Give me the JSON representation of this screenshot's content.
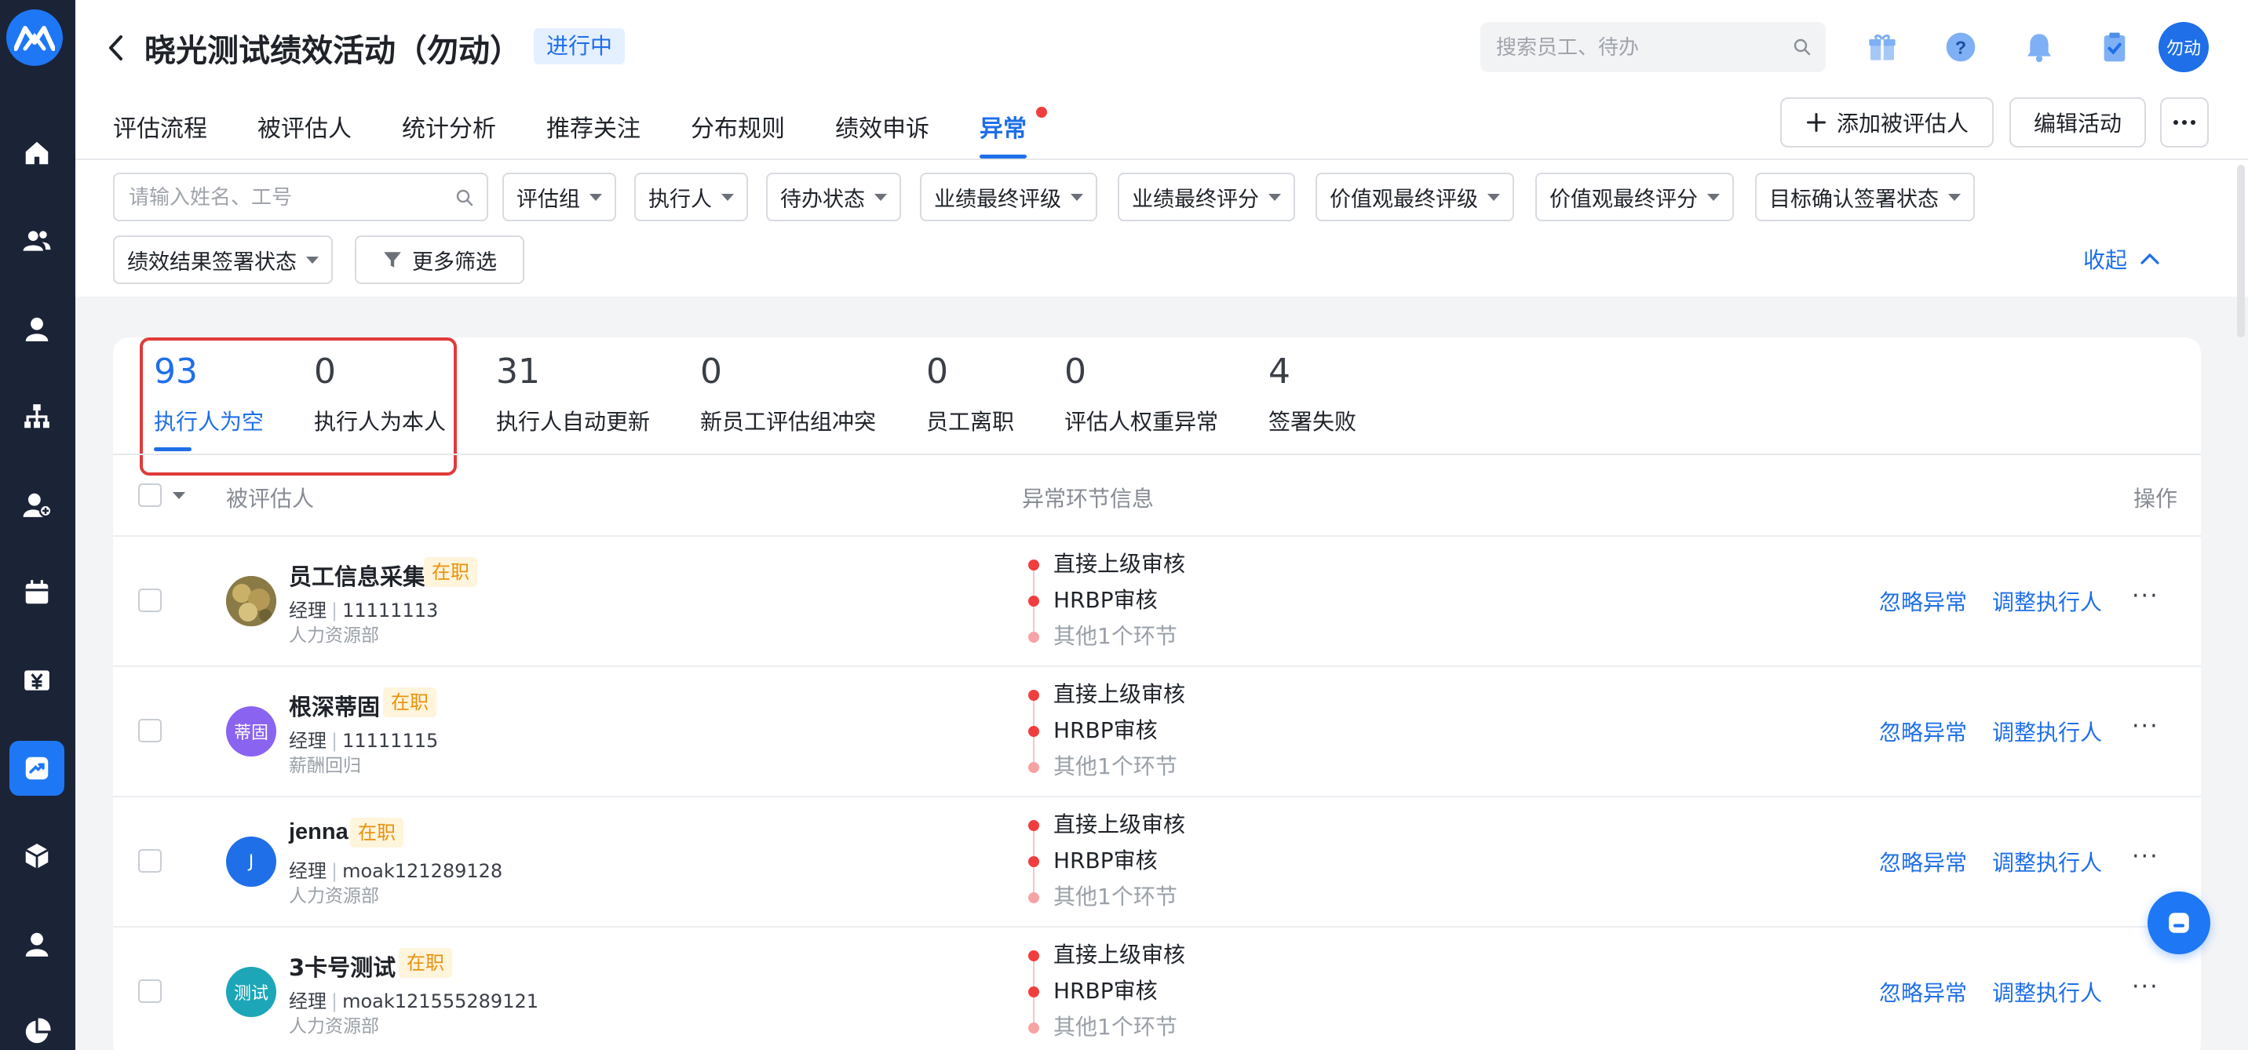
{
  "header": {
    "title": "晓光测试绩效活动（勿动）",
    "status": "进行中",
    "search_placeholder": "搜索员工、待办",
    "user_avatar": "勿动"
  },
  "tabs": [
    {
      "label": "评估流程"
    },
    {
      "label": "被评估人"
    },
    {
      "label": "统计分析"
    },
    {
      "label": "推荐关注"
    },
    {
      "label": "分布规则"
    },
    {
      "label": "绩效申诉"
    },
    {
      "label": "异常",
      "active": true,
      "dot": true
    }
  ],
  "actions": {
    "add_evaluatee": "添加被评估人",
    "edit_activity": "编辑活动"
  },
  "filters": {
    "name_placeholder": "请输入姓名、工号",
    "selects": [
      "评估组",
      "执行人",
      "待办状态",
      "业绩最终评级",
      "业绩最终评分",
      "价值观最终评级",
      "价值观最终评分",
      "目标确认签署状态",
      "绩效结果签署状态"
    ],
    "more": "更多筛选",
    "collapse": "收起"
  },
  "stats": [
    {
      "value": "93",
      "label": "执行人为空",
      "active": true
    },
    {
      "value": "0",
      "label": "执行人为本人"
    },
    {
      "value": "31",
      "label": "执行人自动更新"
    },
    {
      "value": "0",
      "label": "新员工评估组冲突"
    },
    {
      "value": "0",
      "label": "员工离职"
    },
    {
      "value": "0",
      "label": "评估人权重异常"
    },
    {
      "value": "4",
      "label": "签署失败"
    }
  ],
  "table": {
    "columns": {
      "evaluatee": "被评估人",
      "exception_info": "异常环节信息",
      "operation": "操作"
    },
    "rows": [
      {
        "name": "员工信息采集",
        "status": "在职",
        "title": "经理",
        "id": "11111113",
        "dept": "人力资源部",
        "avatar_text": "",
        "avatar_color": "#9a8a52",
        "steps": [
          "直接上级审核",
          "HRBP审核",
          "其他1个环节"
        ],
        "ignore": "忽略异常",
        "adjust": "调整执行人"
      },
      {
        "name": "根深蒂固",
        "status": "在职",
        "title": "经理",
        "id": "11111115",
        "dept": "薪酬回归",
        "avatar_text": "蒂固",
        "avatar_color": "#8a63f0",
        "steps": [
          "直接上级审核",
          "HRBP审核",
          "其他1个环节"
        ],
        "ignore": "忽略异常",
        "adjust": "调整执行人"
      },
      {
        "name": "jenna",
        "status": "在职",
        "title": "经理",
        "id": "moak121289128",
        "dept": "人力资源部",
        "avatar_text": "J",
        "avatar_color": "#1e6fe8",
        "steps": [
          "直接上级审核",
          "HRBP审核",
          "其他1个环节"
        ],
        "ignore": "忽略异常",
        "adjust": "调整执行人"
      },
      {
        "name": "3卡号测试",
        "status": "在职",
        "title": "经理",
        "id": "moak121555289121",
        "dept": "人力资源部",
        "avatar_text": "测试",
        "avatar_color": "#1ca6b8",
        "steps": [
          "直接上级审核",
          "HRBP审核",
          "其他1个环节"
        ],
        "ignore": "忽略异常",
        "adjust": "调整执行人"
      }
    ]
  },
  "colors": {
    "accent": "#1e6fe8",
    "rail": "#1b2337",
    "tag_bg": "#fff4dc",
    "tag_fg": "#e8920d",
    "alert": "#f03e3e"
  }
}
